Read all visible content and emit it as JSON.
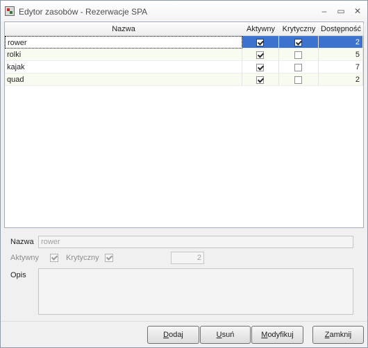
{
  "window": {
    "title": "Edytor zasobów - Rezerwacje SPA",
    "controls": {
      "minimize": "–",
      "maximize": "▭",
      "close": "✕"
    }
  },
  "table": {
    "headers": {
      "name": "Nazwa",
      "active": "Aktywny",
      "critical": "Krytyczny",
      "availability": "Dostępność"
    },
    "rows": [
      {
        "name": "rower",
        "active": true,
        "critical": true,
        "availability": "2",
        "selected": true
      },
      {
        "name": "rolki",
        "active": true,
        "critical": false,
        "availability": "5"
      },
      {
        "name": "kajak",
        "active": true,
        "critical": false,
        "availability": "7"
      },
      {
        "name": "quad",
        "active": true,
        "critical": false,
        "availability": "2"
      }
    ]
  },
  "form": {
    "name_label": "Nazwa",
    "name_value": "rower",
    "active_label": "Aktywny",
    "active_checked": true,
    "critical_label": "Krytyczny",
    "critical_checked": true,
    "availability_value": "2",
    "description_label": "Opis",
    "description_value": ""
  },
  "buttons": {
    "add": {
      "label": "Dodaj",
      "mnemonic": "D"
    },
    "remove": {
      "label": "Usuń",
      "mnemonic": "U"
    },
    "modify": {
      "label": "Modyfikuj",
      "mnemonic": "M"
    },
    "close": {
      "label": "Zamknij",
      "mnemonic": "Z"
    }
  }
}
